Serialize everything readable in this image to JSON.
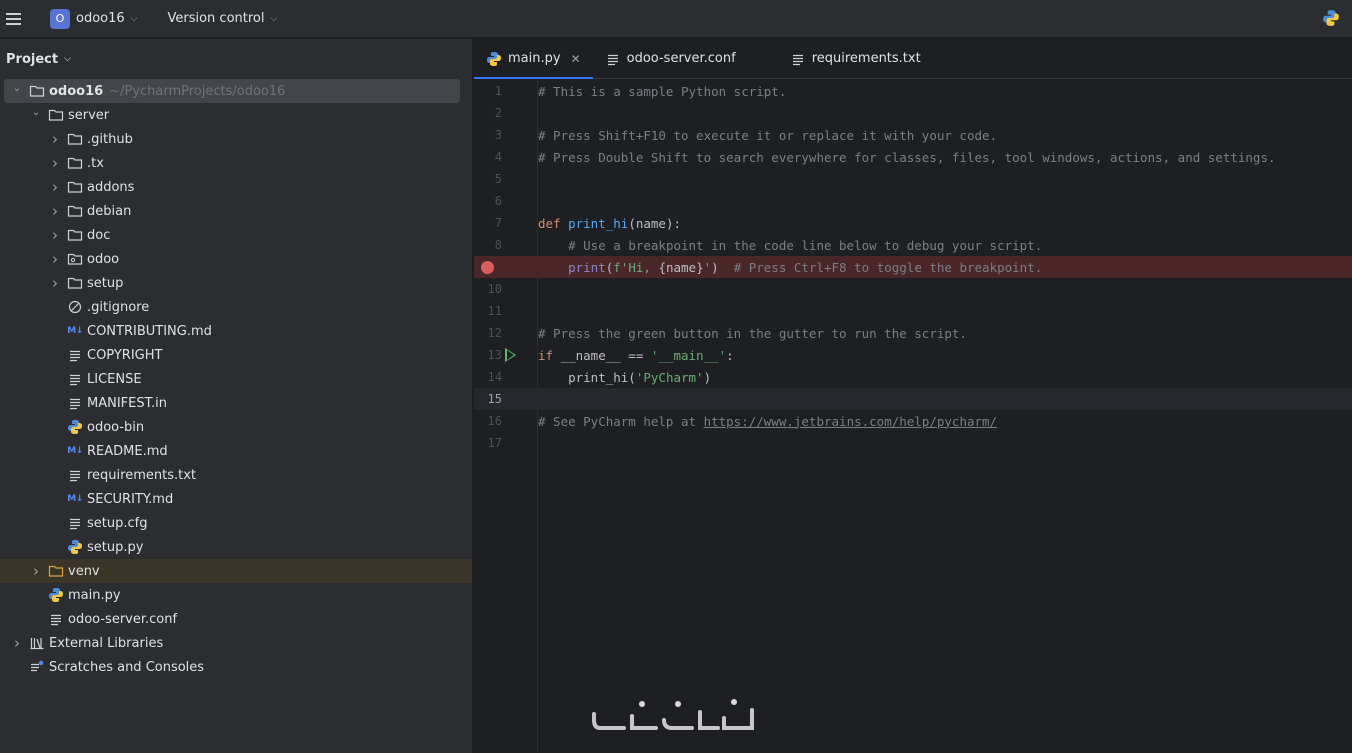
{
  "titlebar": {
    "project_badge": "O",
    "project_name": "odoo16",
    "vcs_label": "Version control"
  },
  "project_panel": {
    "title": "Project",
    "tree": [
      {
        "label": "odoo16",
        "hint": "~/PycharmProjects/odoo16",
        "icon": "folder-icon",
        "depth": 0,
        "arrow": "down",
        "selected": true,
        "bold": true
      },
      {
        "label": "server",
        "icon": "folder-icon",
        "depth": 1,
        "arrow": "down"
      },
      {
        "label": ".github",
        "icon": "folder-icon",
        "depth": 2,
        "arrow": "right"
      },
      {
        "label": ".tx",
        "icon": "folder-icon",
        "depth": 2,
        "arrow": "right"
      },
      {
        "label": "addons",
        "icon": "folder-icon",
        "depth": 2,
        "arrow": "right"
      },
      {
        "label": "debian",
        "icon": "folder-icon",
        "depth": 2,
        "arrow": "right"
      },
      {
        "label": "doc",
        "icon": "folder-icon",
        "depth": 2,
        "arrow": "right"
      },
      {
        "label": "odoo",
        "icon": "package-folder-icon",
        "depth": 2,
        "arrow": "right"
      },
      {
        "label": "setup",
        "icon": "folder-icon",
        "depth": 2,
        "arrow": "right"
      },
      {
        "label": ".gitignore",
        "icon": "ignore-file-icon",
        "depth": 2,
        "arrow": "none"
      },
      {
        "label": "CONTRIBUTING.md",
        "icon": "markdown-icon",
        "depth": 2,
        "arrow": "none"
      },
      {
        "label": "COPYRIGHT",
        "icon": "text-file-icon",
        "depth": 2,
        "arrow": "none"
      },
      {
        "label": "LICENSE",
        "icon": "text-file-icon",
        "depth": 2,
        "arrow": "none"
      },
      {
        "label": "MANIFEST.in",
        "icon": "text-file-icon",
        "depth": 2,
        "arrow": "none"
      },
      {
        "label": "odoo-bin",
        "icon": "python-icon",
        "depth": 2,
        "arrow": "none"
      },
      {
        "label": "README.md",
        "icon": "markdown-icon",
        "depth": 2,
        "arrow": "none"
      },
      {
        "label": "requirements.txt",
        "icon": "text-file-icon",
        "depth": 2,
        "arrow": "none"
      },
      {
        "label": "SECURITY.md",
        "icon": "markdown-icon",
        "depth": 2,
        "arrow": "none"
      },
      {
        "label": "setup.cfg",
        "icon": "text-file-icon",
        "depth": 2,
        "arrow": "none"
      },
      {
        "label": "setup.py",
        "icon": "python-icon",
        "depth": 2,
        "arrow": "none"
      },
      {
        "label": "venv",
        "icon": "excluded-folder-icon",
        "depth": 1,
        "arrow": "right",
        "highlight": true
      },
      {
        "label": "main.py",
        "icon": "python-icon",
        "depth": 1,
        "arrow": "none"
      },
      {
        "label": "odoo-server.conf",
        "icon": "text-file-icon",
        "depth": 1,
        "arrow": "none"
      },
      {
        "label": "External Libraries",
        "icon": "library-icon",
        "depth": 0,
        "arrow": "right"
      },
      {
        "label": "Scratches and Consoles",
        "icon": "scratches-icon",
        "depth": 0,
        "arrow": "none"
      }
    ]
  },
  "editor": {
    "tabs": [
      {
        "label": "main.py",
        "icon": "python-icon",
        "active": true,
        "closable": true
      },
      {
        "label": "odoo-server.conf",
        "icon": "text-file-icon"
      },
      {
        "label": "requirements.txt",
        "icon": "text-file-icon"
      }
    ],
    "breakpoint_line": 9,
    "run_line": 13,
    "current_line": 15,
    "lines": [
      {
        "n": "1",
        "tokens": [
          [
            "cm",
            "# This is a sample Python script."
          ]
        ]
      },
      {
        "n": "2",
        "tokens": []
      },
      {
        "n": "3",
        "tokens": [
          [
            "cm",
            "# Press Shift+F10 to execute it or replace it with your code."
          ]
        ]
      },
      {
        "n": "4",
        "tokens": [
          [
            "cm",
            "# Press Double Shift to search everywhere for classes, files, tool windows, actions, and settings."
          ]
        ]
      },
      {
        "n": "5",
        "tokens": []
      },
      {
        "n": "6",
        "tokens": []
      },
      {
        "n": "7",
        "tokens": [
          [
            "kw",
            "def "
          ],
          [
            "fn",
            "print_hi"
          ],
          [
            "",
            "(name):"
          ]
        ]
      },
      {
        "n": "8",
        "tokens": [
          [
            "",
            "    "
          ],
          [
            "cm",
            "# Use a breakpoint in the code line below to debug your script."
          ]
        ]
      },
      {
        "n": "",
        "tokens": [
          [
            "",
            "    "
          ],
          [
            "bi",
            "print"
          ],
          [
            "",
            "("
          ],
          [
            "str",
            "f'Hi, "
          ],
          [
            "",
            "{name}"
          ],
          [
            "str",
            "'"
          ],
          [
            "",
            ")  "
          ],
          [
            "cm",
            "# Press Ctrl+F8 to toggle the breakpoint."
          ]
        ]
      },
      {
        "n": "10",
        "tokens": []
      },
      {
        "n": "11",
        "tokens": []
      },
      {
        "n": "12",
        "tokens": [
          [
            "cm",
            "# Press the green button in the gutter to run the script."
          ]
        ]
      },
      {
        "n": "13",
        "tokens": [
          [
            "kw",
            "if "
          ],
          [
            "",
            "__name__ == "
          ],
          [
            "str",
            "'__main__'"
          ],
          [
            "",
            ":"
          ]
        ]
      },
      {
        "n": "14",
        "tokens": [
          [
            "",
            "    print_hi("
          ],
          [
            "str",
            "'PyCharm'"
          ],
          [
            "",
            ")"
          ]
        ]
      },
      {
        "n": "15",
        "tokens": []
      },
      {
        "n": "16",
        "tokens": [
          [
            "cm",
            "# See PyCharm help at "
          ],
          [
            "lnk",
            "https://www.jetbrains.com/help/pycharm/"
          ]
        ]
      },
      {
        "n": "17",
        "tokens": []
      }
    ]
  },
  "colors": {
    "accent": "#3574f0",
    "breakpoint": "#db5c5c",
    "run": "#5fb865"
  }
}
